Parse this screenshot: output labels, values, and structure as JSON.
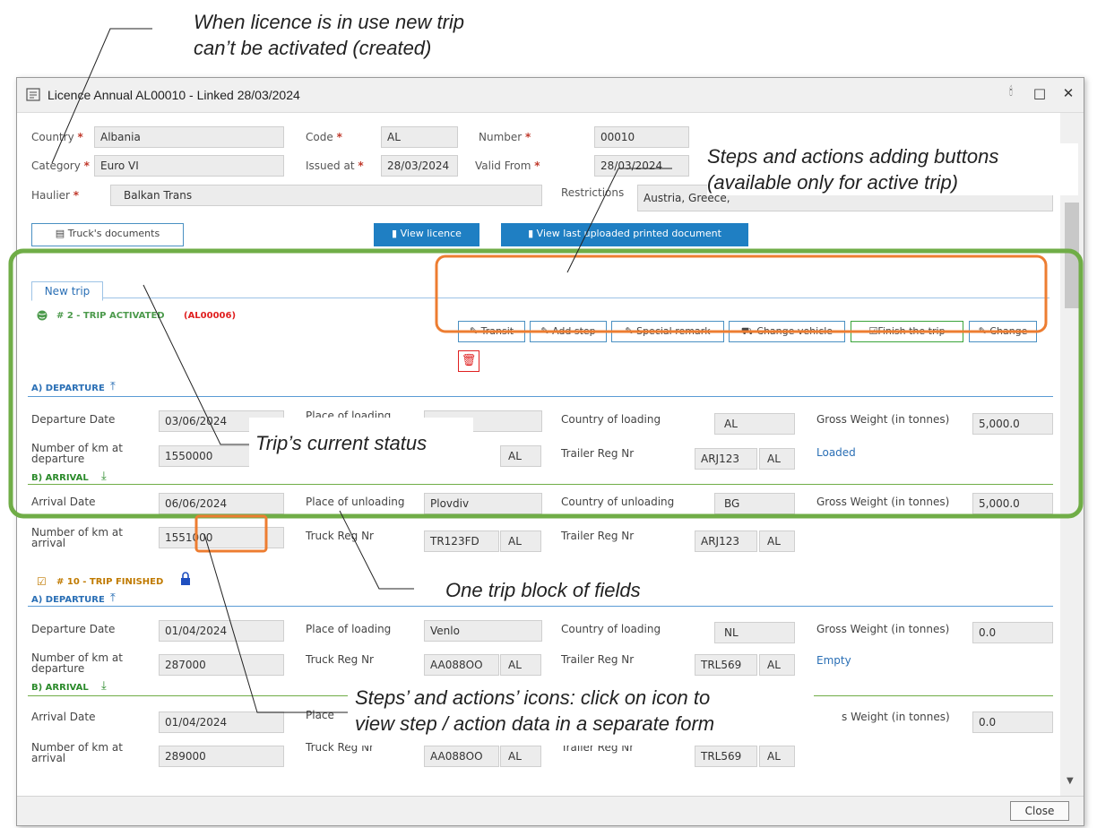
{
  "annotations": {
    "licence_in_use": [
      "When licence is in use new trip",
      "can’t be activated (created)"
    ],
    "steps_buttons": [
      "Steps and actions adding buttons",
      "(available only for active trip)"
    ],
    "trip_status": "Trip’s current status",
    "trip_block": "One trip block of fields",
    "steps_icons": [
      "Steps’ and actions’ icons: click on icon to",
      "view step / action data in a separate form"
    ]
  },
  "window": {
    "title": "Licence Annual AL00010 - Linked 28/03/2024",
    "close_label": "Close"
  },
  "licence": {
    "country_label": "Country",
    "country": "Albania",
    "code_label": "Code",
    "code": "AL",
    "number_label": "Number",
    "number": "00010",
    "category_label": "Category",
    "category": "Euro VI",
    "issued_label": "Issued at",
    "issued": "28/03/2024",
    "valid_from_label": "Valid From",
    "valid_from": "28/03/2024",
    "haulier_label": "Haulier",
    "haulier": "Balkan Trans",
    "restrictions_label": "Restrictions",
    "restrictions": "Austria, Greece,",
    "required_mark": "*"
  },
  "toolbar": {
    "truck_docs": "Truck's documents",
    "view_licence": "View licence",
    "view_last_doc": "View last uploaded printed document"
  },
  "tabs": {
    "new_trip": "New trip"
  },
  "active_trip": {
    "status": "# 2 - TRIP ACTIVATED",
    "licence_ref": "(AL00006)",
    "buttons": {
      "transit": "Transit",
      "add_step": "Add step",
      "special_remark": "Special remark",
      "change_vehicle": "Change vehicle",
      "finish": "Finish the trip",
      "change": "Change"
    },
    "departure_section": "A) DEPARTURE",
    "arrival_section": "B) ARRIVAL",
    "departure_date": "03/06/2024",
    "place_loading": "",
    "country_loading": "AL",
    "gross_weight": "5,000.0",
    "km_departure": "1550000",
    "truck_country": "AL",
    "trailer_reg": "ARJ123",
    "trailer_country": "AL",
    "load_status": "Loaded",
    "arrival_date": "06/06/2024",
    "place_unloading": "Plovdiv",
    "country_unloading": "BG",
    "gross_weight_arr": "5,000.0",
    "km_arrival": "1551000",
    "truck_reg_arr": "TR123FD",
    "truck_country_arr": "AL",
    "trailer_reg_arr": "ARJ123",
    "trailer_country_arr": "AL"
  },
  "finished_trip": {
    "status": "# 10 - TRIP FINISHED",
    "departure_section": "A) DEPARTURE",
    "arrival_section": "B) ARRIVAL",
    "departure_date": "01/04/2024",
    "place_loading": "Venlo",
    "country_loading": "NL",
    "gross_weight": "0.0",
    "km_departure": "287000",
    "truck_reg": "AA088OO",
    "truck_country": "AL",
    "trailer_reg": "TRL569",
    "trailer_country": "AL",
    "load_status": "Empty",
    "arrival_date": "01/04/2024",
    "gross_weight_arr": "0.0",
    "km_arrival": "289000",
    "truck_reg_arr": "AA088OO",
    "truck_country_arr": "AL",
    "trailer_reg_arr": "TRL569",
    "trailer_country_arr": "AL"
  },
  "field_labels": {
    "departure_date": "Departure Date",
    "place_loading": "Place of loading",
    "country_loading": "Country of loading",
    "gross_weight": "Gross Weight (in tonnes)",
    "km_departure_1": "Number of km at",
    "km_departure_2": "departure",
    "trailer_reg": "Trailer Reg Nr",
    "truck_reg": "Truck Reg Nr",
    "arrival_date": "Arrival Date",
    "place_unloading": "Place of unloading",
    "place_short": "Place",
    "country_unloading": "Country of unloading",
    "weight_short": "s Weight (in tonnes)",
    "km_arrival_1": "Number of km at",
    "km_arrival_2": "arrival"
  },
  "colors": {
    "green_highlight": "#70ad47",
    "orange_highlight": "#ed7d31",
    "accent_blue": "#1f7fc3"
  }
}
